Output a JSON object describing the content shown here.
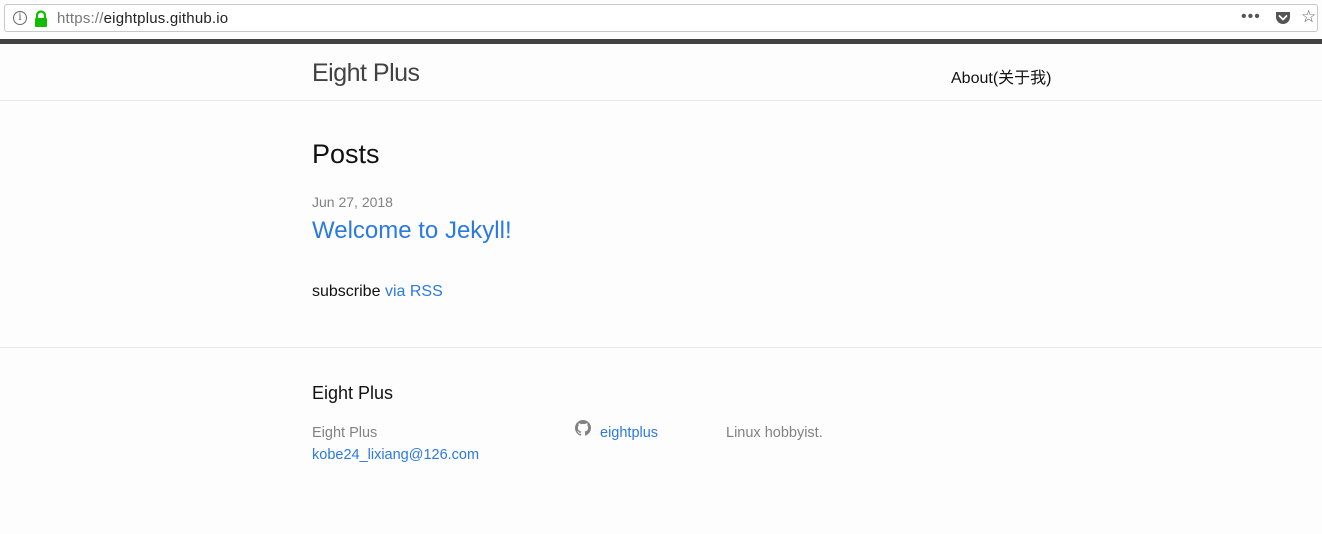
{
  "browser": {
    "url_scheme": "https://",
    "url_host": "eightplus.github.io",
    "menu_dots": "•••",
    "star": "☆"
  },
  "colors": {
    "link": "#2a7ae2",
    "secure_lock": "#12bc00",
    "meta_gray": "#828282",
    "top_bar": "#424242"
  },
  "header": {
    "site_title": "Eight Plus",
    "nav": [
      {
        "label": "About(关于我)"
      }
    ]
  },
  "main": {
    "heading": "Posts",
    "posts": [
      {
        "date": "Jun 27, 2018",
        "title": "Welcome to Jekyll!"
      }
    ],
    "rss_prefix": "subscribe",
    "rss_link": "via RSS"
  },
  "footer": {
    "heading": "Eight Plus",
    "name": "Eight Plus",
    "email": "kobe24_lixiang@126.com",
    "github_username": "eightplus",
    "description": "Linux hobbyist."
  },
  "icons": [
    "info-icon",
    "lock-icon",
    "menu-dots-icon",
    "pocket-icon",
    "star-icon",
    "github-icon"
  ]
}
